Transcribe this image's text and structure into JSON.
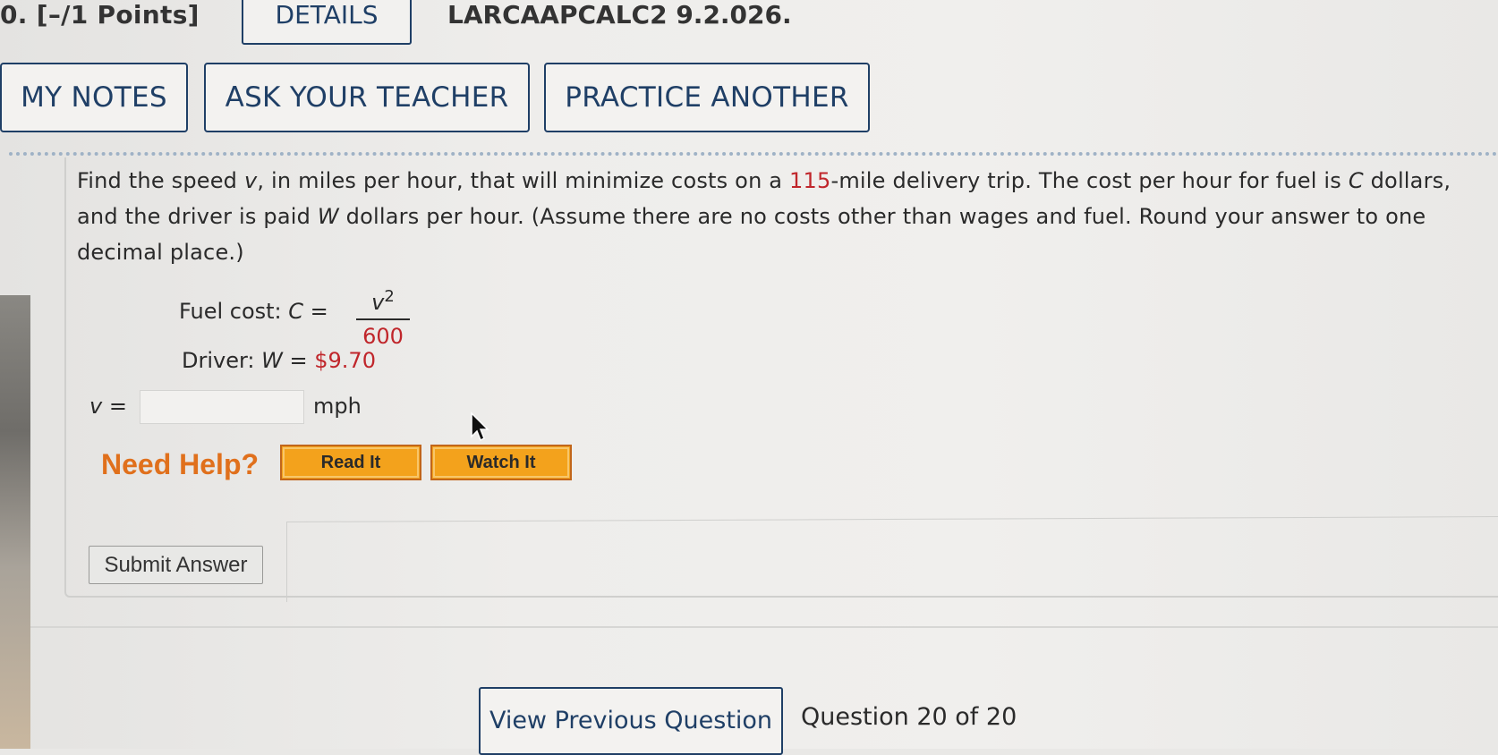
{
  "header": {
    "points": "0.  [–/1 Points]",
    "details_label": "DETAILS",
    "problem_code": "LARCAAPCALC2 9.2.026."
  },
  "actions": {
    "my_notes": "MY NOTES",
    "ask_teacher": "ASK YOUR TEACHER",
    "practice_another": "PRACTICE ANOTHER"
  },
  "question": {
    "text_part1": "Find the speed ",
    "var_v": "v",
    "text_part2": ", in miles per hour, that will minimize costs on a ",
    "distance": "115",
    "text_part3": "-mile delivery trip. The cost per hour for fuel is ",
    "var_c": "C",
    "text_part4": " dollars, and the driver is paid ",
    "var_w": "W",
    "text_part5": " dollars per hour. (Assume there are no costs other than wages and fuel. Round your answer to one decimal place.)",
    "fuel_label": "Fuel cost:  ",
    "fuel_var": "C",
    "fuel_eq": " = ",
    "fuel_num_var": "v",
    "fuel_num_exp": "2",
    "fuel_den": "600",
    "driver_label": "Driver:  ",
    "driver_var": "W",
    "driver_eq": " = ",
    "driver_wage": "$9.70",
    "answer_var": "v =",
    "answer_value": "",
    "answer_unit": "mph"
  },
  "help": {
    "need_help": "Need Help?",
    "read_it": "Read It",
    "watch_it": "Watch It"
  },
  "submit": {
    "label": "Submit Answer"
  },
  "footer": {
    "prev_question": "View Previous Question",
    "counter": "Question 20 of 20"
  }
}
